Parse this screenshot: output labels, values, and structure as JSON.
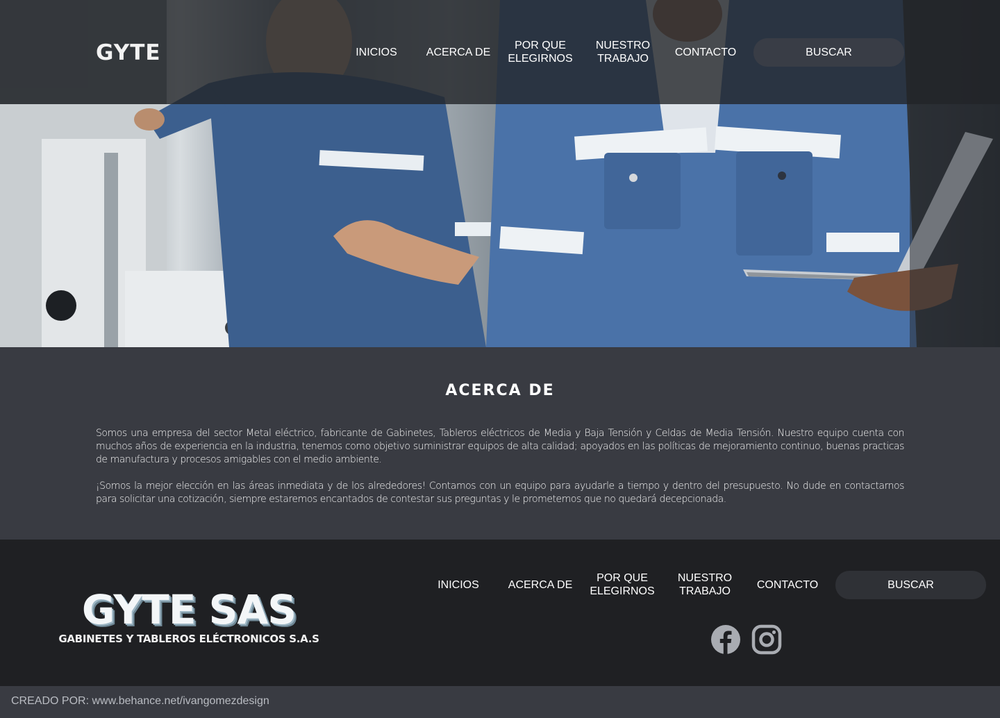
{
  "header": {
    "logo": "GYTE",
    "nav": [
      {
        "label": "INICIOS"
      },
      {
        "label": "ACERCA DE"
      },
      {
        "label": "POR QUE\nELEGIRNOS"
      },
      {
        "label": "NUESTRO\nTRABAJO"
      },
      {
        "label": "CONTACTO"
      }
    ],
    "search_label": "BUSCAR"
  },
  "hero": {
    "image": "workers in blue uniforms in an electrical cabinet factory"
  },
  "about": {
    "title": "ACERCA DE",
    "paragraph1": "Somos una empresa del sector Metal eléctrico, fabricante de Gabinetes, Tableros eléctricos de Media y Baja Tensión y Celdas de Media Tensión. Nuestro equipo cuenta con muchos años de experiencia en la industria, tenemos como objetivo suministrar equipos de alta calidad; apoyados en las políticas de mejoramiento continuo, buenas practicas de manufactura y procesos amigables con el medio ambiente.",
    "paragraph2": "¡Somos la mejor elección en las áreas inmediata y de los alrededores! Contamos con un equipo para ayudarle a tiempo y dentro del presupuesto. No dude en contactarnos para solicitar una cotización, siempre estaremos encantados de contestar sus preguntas y le prometemos que no quedará decepcionada."
  },
  "footer": {
    "brand": "GYTE SAS",
    "brand_sub": "GABINETES Y TABLEROS ELÉCTRONICOS S.A.S",
    "nav": [
      {
        "label": "INICIOS"
      },
      {
        "label": "ACERCA DE"
      },
      {
        "label": "POR QUE\nELEGIRNOS"
      },
      {
        "label": "NUESTRO\nTRABAJO"
      },
      {
        "label": "CONTACTO"
      }
    ],
    "search_label": "BUSCAR",
    "social": [
      "facebook-icon",
      "instagram-icon"
    ],
    "icon_color": "#a9acb2"
  },
  "credit": {
    "text": "CREADO POR: www.behance.net/ivangomezdesign"
  },
  "colors": {
    "topbar": "#222428",
    "about_bg": "#393b42",
    "footer_bg": "#1f2023",
    "button_bg": "#2f3136",
    "uniform_blue": "#4a72a8"
  }
}
